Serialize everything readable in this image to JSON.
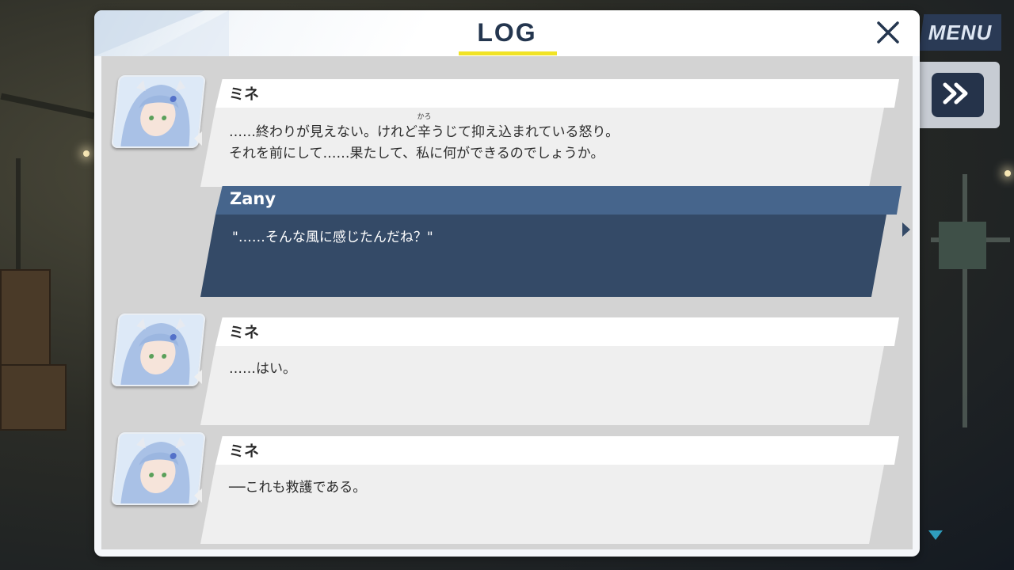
{
  "menu": {
    "label": "MENU"
  },
  "log": {
    "title": "LOG",
    "entries": [
      {
        "speaker": "ミネ",
        "lines": [
          {
            "before": "……終わりが見えない。けれど",
            "ruby_base": "辛",
            "ruby_text": "かろ",
            "after": "うじて抑え込まれている怒り。"
          },
          {
            "text": "それを前にして……果たして、私に何ができるのでしょうか。"
          }
        ]
      },
      {
        "speaker": "Zany",
        "lines": [
          {
            "text": "\"……そんな風に感じたんだね？\""
          }
        ]
      },
      {
        "speaker": "ミネ",
        "lines": [
          {
            "text": "……はい。"
          }
        ]
      },
      {
        "speaker": "ミネ",
        "lines": [
          {
            "text": "──これも救護である。"
          }
        ]
      }
    ]
  },
  "colors": {
    "player_name_bar": "#46658c",
    "player_text_box": "#344a67",
    "title_underline": "#f1e325",
    "title_text": "#24364f"
  },
  "icons": {
    "close": "close-icon",
    "skip": "fast-forward-icon",
    "scroll": "scroll-down-icon"
  }
}
